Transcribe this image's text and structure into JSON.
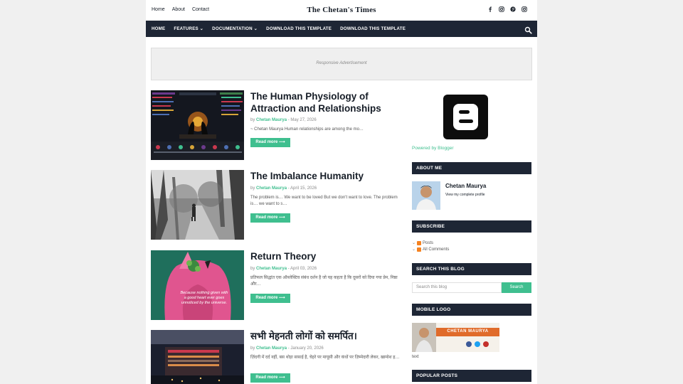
{
  "topbar": {
    "links": [
      "Home",
      "About",
      "Contact"
    ],
    "brand": "The Chetan's Times",
    "socials": [
      "facebook-icon",
      "instagram-icon",
      "pinterest-icon",
      "instagram-icon"
    ]
  },
  "nav": {
    "items": [
      "HOME",
      "FEATURES ⌄",
      "DOCUMENTATION ⌄",
      "DOWNLOAD THIS TEMPLATE",
      "DOWNLOAD THIS TEMPLATE"
    ]
  },
  "ad": {
    "label": "Responsive Advertisement"
  },
  "posts": [
    {
      "title": "The Human Physiology of Attraction and Relationships",
      "by": "by",
      "author": "Chetan Maurya",
      "sep": " - ",
      "date": "May 27, 2026",
      "excerpt": "~ Chetan Maurya                  Human relationships are among the mo…",
      "read_more": "Read more ⟶"
    },
    {
      "title": "The Imbalance Humanity",
      "by": "by",
      "author": "Chetan Maurya",
      "sep": " - ",
      "date": "April 15, 2026",
      "excerpt": "The problem is… We want to be loved But we don't want to love. The problem is… we want to s…",
      "read_more": "Read more ⟶"
    },
    {
      "title": "Return Theory",
      "by": "by",
      "author": "Chetan Maurya",
      "sep": " - ",
      "date": "April 03, 2026",
      "excerpt": "प्रतिफल सिद्धांत एक ऑब्जेक्टिव संबंध दर्शन है जो यह कहता है कि दूसरों को दिया गया प्रेम, निष्ठा और…",
      "read_more": "Read more ⟶",
      "quote": "Because nothing given with a good heart ever goes unnoticed by the universe."
    },
    {
      "title": "सभी मेहनती लोगों को समर्पित।",
      "by": "by",
      "author": "Chetan Maurya",
      "sep": " - ",
      "date": "January 20, 2026",
      "excerpt": "ज़िंदगी में दर्द नहीं, बस थोड़ा सफ़ाई है, चेहरे पर मायूसी और कंधों पर ज़िम्मेदारी लेकर, खामोश ह…",
      "read_more": "Read more ⟶"
    }
  ],
  "sidebar": {
    "powered": "Powered by Blogger",
    "about_title": "ABOUT ME",
    "about_name": "Chetan Maurya",
    "about_link": "View my complete profile",
    "subscribe_title": "SUBSCRIBE",
    "subscribe_items": [
      "Posts",
      "All Comments"
    ],
    "search_title": "SEARCH THIS BLOG",
    "search_placeholder": "Search this blog",
    "search_button": "Search",
    "mobile_logo_title": "MOBILE LOGO",
    "mobile_logo_text": "CHETAN MAURYA",
    "mobile_logo_caption": "text",
    "popular_title": "POPULAR POSTS"
  },
  "colors": {
    "nav_bg": "#1e2635",
    "accent": "#3fbf8f",
    "text": "#161d27"
  }
}
